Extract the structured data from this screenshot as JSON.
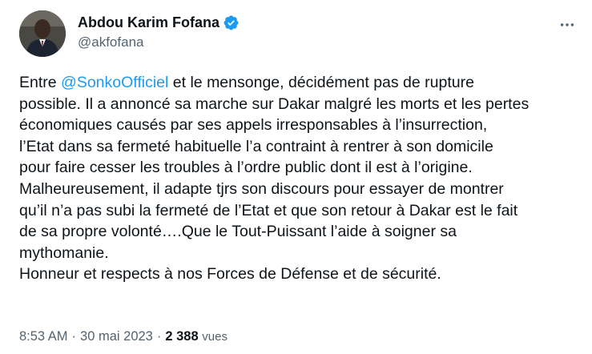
{
  "author": {
    "name": "Abdou Karim Fofana",
    "handle": "@akfofana",
    "verified_icon": "verified-badge-icon",
    "avatar_icon": "profile-photo"
  },
  "more_icon": "ellipsis-icon",
  "tweet": {
    "line1_prefix": "Entre ",
    "mention": "@SonkoOfficiel",
    "line1_suffix": " et le mensonge, décidément pas de rupture",
    "lines": [
      "possible. Il a annoncé sa marche sur Dakar malgré les morts et les pertes",
      "économiques causés par ses appels irresponsables à l’insurrection,",
      "l’Etat dans sa fermeté habituelle l’a contraint à rentrer à son domicile",
      "pour faire cesser les troubles à l’ordre public dont il est à l’origine.",
      "Malheureusement, il adapte tjrs son discours pour essayer de montrer",
      "qu’il n’a pas subi la fermeté de l’Etat et que son retour à Dakar est le fait",
      "de sa propre volonté….Que le Tout-Puissant l’aide à soigner sa",
      "mythomanie.",
      "Honneur et respects à nos Forces de Défense et de sécurité."
    ]
  },
  "meta": {
    "time": "8:53 AM",
    "separator": "·",
    "date": "30 mai 2023",
    "views_count": "2 388",
    "views_label": "vues"
  },
  "colors": {
    "text": "#0f1419",
    "secondary": "#536471",
    "accent": "#1d9bf0"
  }
}
